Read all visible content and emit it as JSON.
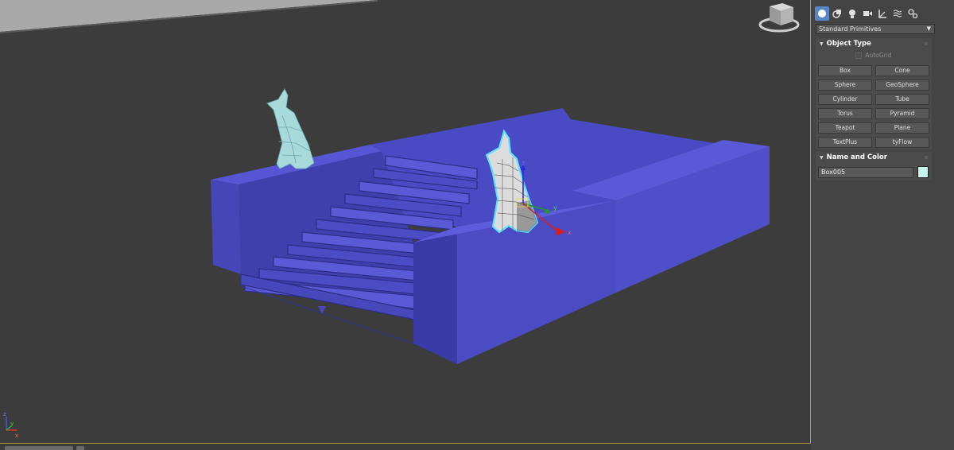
{
  "viewport": {
    "gizmo_labels": {
      "x": "x",
      "y": "y",
      "z": "z"
    },
    "mini_axis_labels": {
      "x": "x",
      "y": "y",
      "z": "z"
    },
    "colors": {
      "background": "#3c3c3c",
      "blue_object": "#5151d0",
      "selection": "#5fe2ff",
      "wire_object": "#a6d8dc"
    }
  },
  "panel": {
    "tabs": [
      {
        "icon": "create-icon",
        "active": true
      },
      {
        "icon": "shapes-icon",
        "active": false
      },
      {
        "icon": "lights-icon",
        "active": false
      },
      {
        "icon": "cameras-icon",
        "active": false
      },
      {
        "icon": "helpers-icon",
        "active": false
      },
      {
        "icon": "spacewarps-icon",
        "active": false
      },
      {
        "icon": "systems-icon",
        "active": false
      }
    ],
    "category": "Standard Primitives",
    "object_type": {
      "title": "Object Type",
      "autogrid": "AutoGrid",
      "buttons": [
        "Box",
        "Cone",
        "Sphere",
        "GeoSphere",
        "Cylinder",
        "Tube",
        "Torus",
        "Pyramid",
        "Teapot",
        "Plane",
        "TextPlus",
        "tyFlow"
      ]
    },
    "name_color": {
      "title": "Name and Color",
      "name": "Box005",
      "color": "#c8f4ee"
    }
  }
}
